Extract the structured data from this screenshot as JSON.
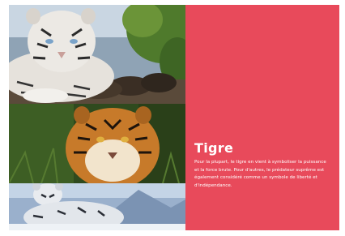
{
  "panel": {
    "title": "Tigre",
    "body": "Pour la plupart, le tigre en vient à symboliser la puissance et la force brute. Pour d'autres, le prédateur suprême est également considéré comme un symbole de liberté et d'indépendance.",
    "background": "#e84a5b",
    "text_color": "#ffffff"
  },
  "photos": [
    {
      "subject": "white-tiger-resting-on-logs"
    },
    {
      "subject": "bengal-tiger-face-in-grass"
    },
    {
      "subject": "white-tiger-in-snow"
    }
  ]
}
